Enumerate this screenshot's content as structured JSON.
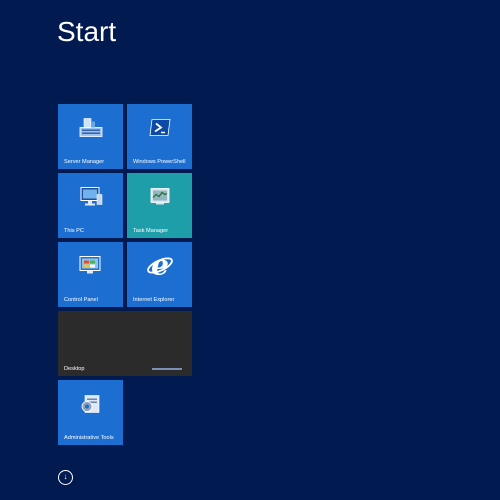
{
  "header": {
    "title": "Start"
  },
  "tiles": [
    {
      "label": "Server Manager",
      "icon": "server-manager-icon"
    },
    {
      "label": "Windows PowerShell",
      "icon": "powershell-icon"
    },
    {
      "label": "This PC",
      "icon": "this-pc-icon"
    },
    {
      "label": "Task Manager",
      "icon": "task-manager-icon"
    },
    {
      "label": "Control Panel",
      "icon": "control-panel-icon"
    },
    {
      "label": "Internet Explorer",
      "icon": "internet-explorer-icon"
    },
    {
      "label": "Desktop",
      "icon": "desktop-icon"
    },
    {
      "label": "Administrative Tools",
      "icon": "administrative-tools-icon"
    }
  ],
  "apps_button": {
    "icon": "down-arrow-icon",
    "glyph": "↓"
  },
  "colors": {
    "background": "#011a50",
    "tile_blue": "#1c6fd1",
    "tile_teal": "#1e9ea8",
    "tile_dark": "#2b2b2b"
  }
}
